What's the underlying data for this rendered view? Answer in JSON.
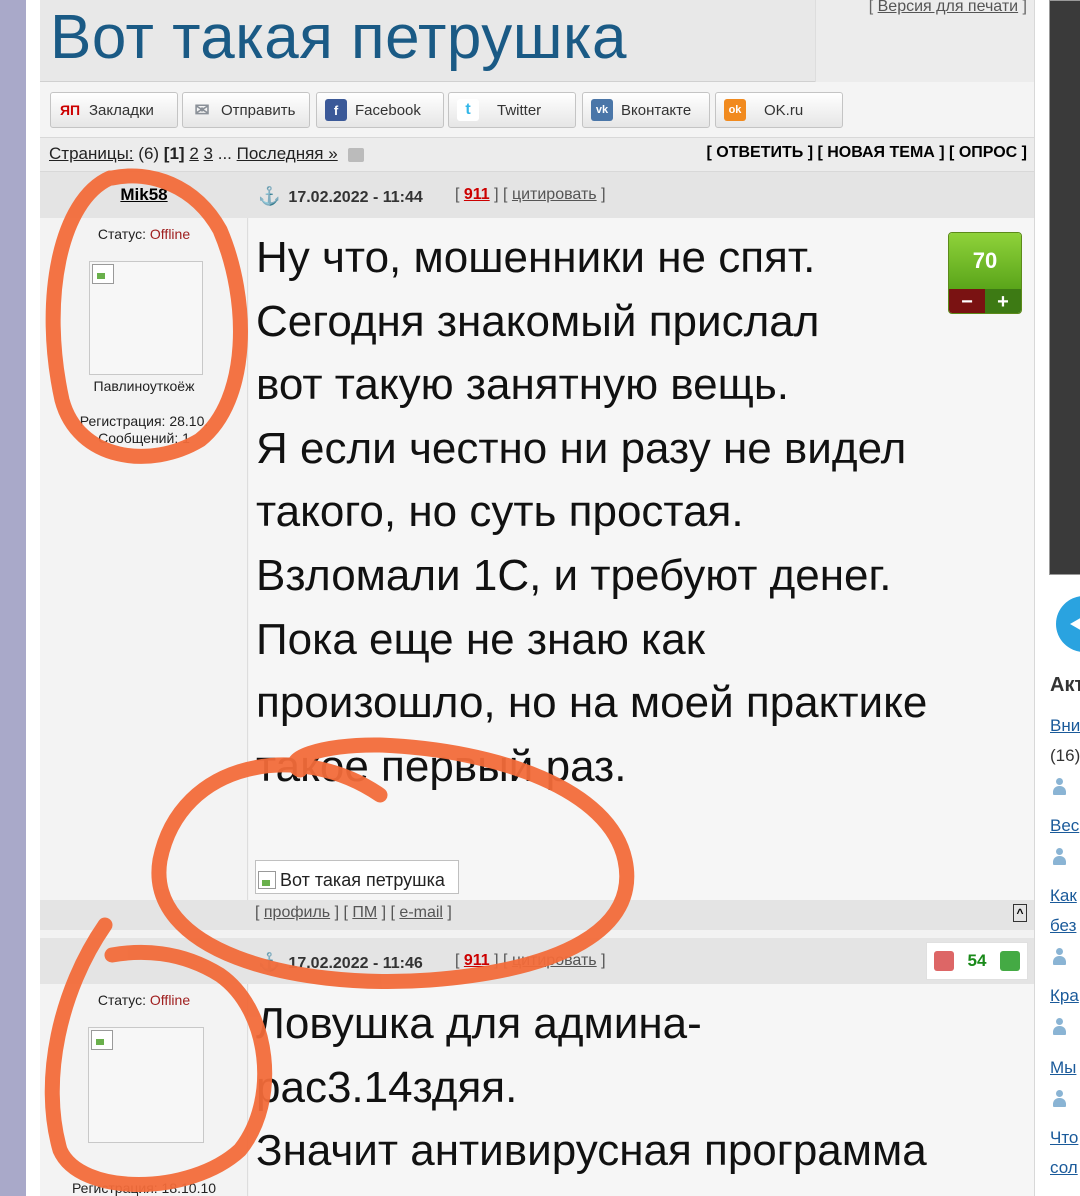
{
  "topic": {
    "title": "Вот такая петрушка",
    "print_version": "Версия для печати"
  },
  "share": [
    {
      "label": "Закладки",
      "icon": "yandex-bookmark-icon",
      "icon_text": "ЯП",
      "color": "#cc0000"
    },
    {
      "label": "Отправить",
      "icon": "envelope-icon",
      "icon_text": "✉",
      "color": "#9aa0a8"
    },
    {
      "label": "Facebook",
      "icon": "facebook-icon",
      "icon_text": "f",
      "color": "#3b5998"
    },
    {
      "label": "Twitter",
      "icon": "twitter-icon",
      "icon_text": "t",
      "color": "#34b7e8"
    },
    {
      "label": "Вконтакте",
      "icon": "vk-icon",
      "icon_text": "vk",
      "color": "#4a76a8"
    },
    {
      "label": "OK.ru",
      "icon": "odnoklassniki-icon",
      "icon_text": "ok",
      "color": "#f18a1e"
    }
  ],
  "pager": {
    "label": "Страницы:",
    "count": "(6)",
    "current": "[1]",
    "page2": "2",
    "page3": "3",
    "ellipsis": "...",
    "last": "Последняя »",
    "actions": "[ ОТВЕТИТЬ ] [ НОВАЯ ТЕМА ] [ ОПРОС ]"
  },
  "posts": [
    {
      "author": "Mik58",
      "status_label": "Статус:",
      "status_value": "Offline",
      "avatar_caption": "Павлиноуткоёж",
      "registration": "Регистрация: 28.10.",
      "messages": "Сообщений: 1",
      "date": "17.02.2022 - 11:44",
      "post_no": "911",
      "quote": "цитировать",
      "rating": "70",
      "lines": [
        "Ну что, мошенники не спят.",
        "Сегодня знакомый прислал",
        "вот такую занятную вещь.",
        "Я если честно ни разу не видел",
        "такого, но суть простая.",
        "Взломали 1С, и требуют денег.",
        "Пока еще не знаю как",
        "произошло, но на моей практике",
        "такое первый раз."
      ],
      "image_alt": "Вот такая петрушка",
      "footer_profile": "профиль",
      "footer_pm": "ПМ",
      "footer_email": "e-mail",
      "up": "^"
    },
    {
      "status_label": "Статус:",
      "status_value": "Offline",
      "registration": "Регистрация: 18.10.10",
      "date": "17.02.2022 - 11:46",
      "post_no": "911",
      "quote": "цитировать",
      "rating": "54",
      "lines": [
        "Ловушка для админа-",
        "рас3.14здяя.",
        "Значит антивирусная программа"
      ]
    }
  ],
  "sidebar": {
    "heading": "Акт",
    "items": [
      {
        "title": "Вни",
        "extra": "(16)"
      },
      {
        "title": "Вес"
      },
      {
        "title": "Как",
        "title2": "без"
      },
      {
        "title": "Кра"
      },
      {
        "title": "Мы"
      },
      {
        "title": "Что",
        "title2": "сол"
      }
    ]
  },
  "colors": {
    "title": "#1a5a85",
    "annotation": "#f26b3a",
    "offline": "#a02020"
  }
}
